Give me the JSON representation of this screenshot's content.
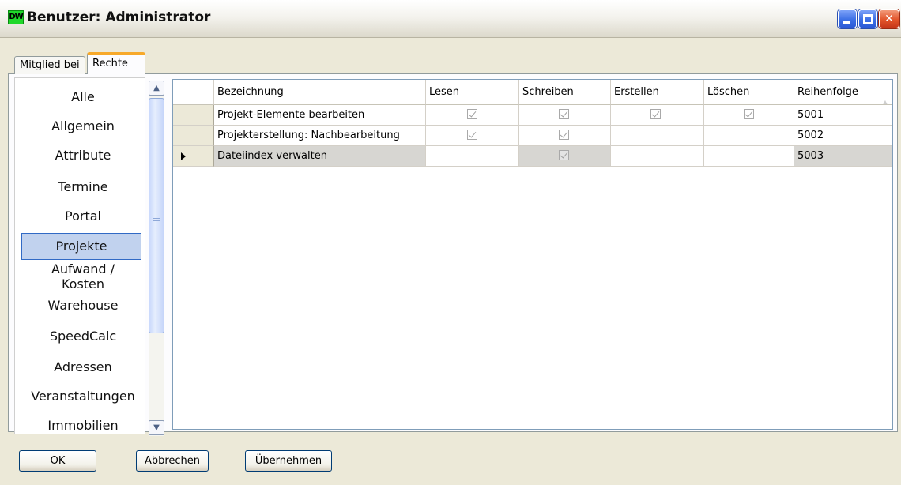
{
  "window": {
    "icon_text": "DW",
    "title": "Benutzer: Administrator"
  },
  "tabs": [
    {
      "label": "Mitglied bei"
    },
    {
      "label": "Rechte",
      "selected": true
    }
  ],
  "categories": [
    {
      "label": "Alle"
    },
    {
      "label": "Allgemein"
    },
    {
      "label": "Attribute"
    },
    {
      "label": "Termine"
    },
    {
      "label": "Portal"
    },
    {
      "label": "Projekte",
      "selected": true
    },
    {
      "label": "Aufwand /"
    },
    {
      "label": "Kosten"
    },
    {
      "label": "Warehouse"
    },
    {
      "label": "SpeedCalc"
    },
    {
      "label": "Adressen"
    },
    {
      "label": "Veranstaltungen"
    },
    {
      "label": "Immobilien"
    }
  ],
  "grid": {
    "columns": [
      "Bezeichnung",
      "Lesen",
      "Schreiben",
      "Erstellen",
      "Löschen",
      "Reihenfolge"
    ],
    "rows": [
      {
        "bezeichnung": "Projekt-Elemente bearbeiten",
        "lesen": true,
        "schreiben": true,
        "erstellen": true,
        "loeschen": true,
        "reihenfolge": "5001"
      },
      {
        "bezeichnung": "Projekterstellung: Nachbearbeitung",
        "lesen": true,
        "schreiben": true,
        "erstellen": false,
        "loeschen": false,
        "reihenfolge": "5002"
      },
      {
        "bezeichnung": "Dateiindex verwalten",
        "lesen": false,
        "schreiben": true,
        "erstellen": false,
        "loeschen": false,
        "reihenfolge": "5003",
        "current": true
      }
    ]
  },
  "buttons": {
    "ok": "OK",
    "cancel": "Abbrechen",
    "apply": "Übernehmen"
  },
  "colors": {
    "selection": "#c1d2ee",
    "tab_accent": "#f7a92a",
    "titlebar_close": "#e2542a",
    "titlebar_button": "#3c6fe5"
  }
}
